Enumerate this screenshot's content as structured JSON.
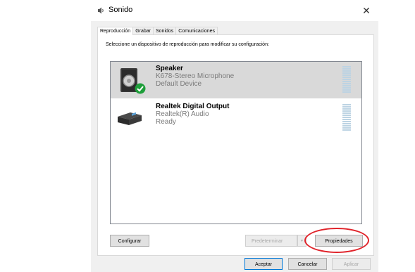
{
  "window": {
    "title": "Sonido",
    "close_glyph": "✕"
  },
  "tabs": [
    {
      "label": "Reproducción",
      "active": true
    },
    {
      "label": "Grabar",
      "active": false
    },
    {
      "label": "Sonidos",
      "active": false
    },
    {
      "label": "Comunicaciones",
      "active": false
    }
  ],
  "instruction": "Seleccione un dispositivo de reproducción para modificar su configuración:",
  "devices": [
    {
      "name": "Speaker",
      "line2": "K678-Stereo Microphone",
      "line3": "Default Device",
      "icon": "speaker-icon",
      "selected": true,
      "default_badge": "check-icon"
    },
    {
      "name": "Realtek Digital Output",
      "line2": "Realtek(R) Audio",
      "line3": "Ready",
      "icon": "digital-output-icon",
      "selected": false
    }
  ],
  "buttons": {
    "configure": "Configurar",
    "set_default": "Predeterminar",
    "set_default_arrow": "▼",
    "properties": "Propiedades",
    "ok": "Aceptar",
    "cancel": "Cancelar",
    "apply": "Aplicar"
  },
  "colors": {
    "highlight_ring": "#e0232a",
    "selection_bg": "#d9d9d9",
    "default_check": "#1e9e3a"
  }
}
